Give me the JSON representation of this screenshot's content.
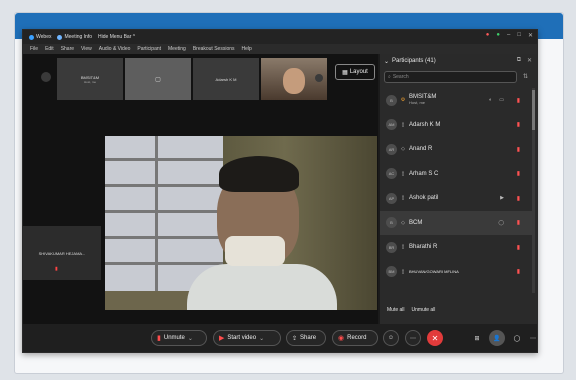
{
  "titlebar": {
    "app_name": "Webex",
    "meeting_info": "Meeting Info",
    "hide_menu_bar": "Hide Menu Bar"
  },
  "menu": [
    "File",
    "Edit",
    "Share",
    "View",
    "Audio & Video",
    "Participant",
    "Meeting",
    "Breakout Sessions",
    "Help"
  ],
  "thumbnails": [
    {
      "name": "BMSIT&M",
      "sub": "Host, me"
    },
    {
      "name": "",
      "sub": ""
    },
    {
      "name": "Adarsh K M",
      "sub": ""
    }
  ],
  "layout_button": "Layout",
  "left_tile": {
    "name": "SHIVAKUMAR HEJAMA..."
  },
  "participants": {
    "title": "Participants (41)",
    "search_placeholder": "Search",
    "rows": [
      {
        "initials": "B",
        "name": "BMSIT&M",
        "sub": "Host, me"
      },
      {
        "initials": "AM",
        "name": "Adarsh K M"
      },
      {
        "initials": "AR",
        "name": "Anand R"
      },
      {
        "initials": "AC",
        "name": "Arham S C"
      },
      {
        "initials": "AP",
        "name": "Ashok patil"
      },
      {
        "initials": "B",
        "name": "BCM"
      },
      {
        "initials": "BR",
        "name": "Bharathi R"
      },
      {
        "initials": "BM",
        "name": "BHUVAN/GOWARI MFLINA"
      }
    ],
    "mute_all": "Mute all",
    "unmute_all": "Unmute all"
  },
  "controls": {
    "unmute": "Unmute",
    "start_video": "Start video",
    "share": "Share",
    "record": "Record"
  },
  "colors": {
    "accent_blue": "#1f6fb8",
    "end_red": "#e23b3b",
    "mute_red": "#ff5252"
  }
}
